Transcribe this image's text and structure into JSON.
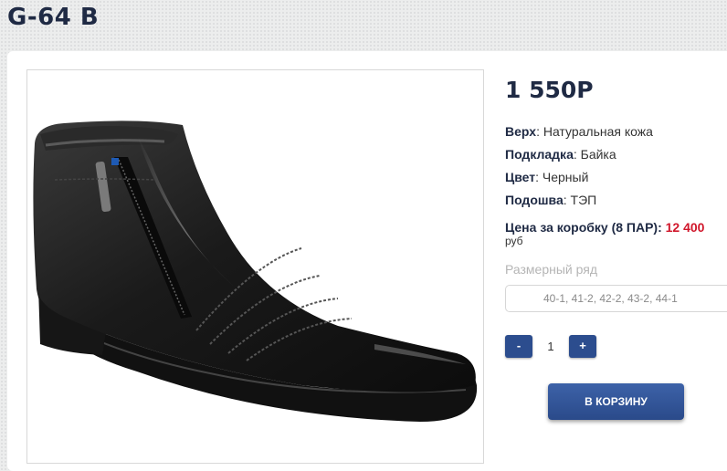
{
  "product": {
    "title": "G-64 B",
    "price": "1 550Р",
    "image_alt": "black leather ankle boot with zipper"
  },
  "specs": [
    {
      "label": "Верх",
      "value": ": Натуральная кожа"
    },
    {
      "label": "Подкладка",
      "value": ": Байка"
    },
    {
      "label": "Цвет",
      "value": ": Черный"
    },
    {
      "label": "Подошва",
      "value": ": ТЭП"
    }
  ],
  "box_price": {
    "label": "Цена за коробку (8 ПАР):",
    "value": "12 400",
    "unit": "руб"
  },
  "sizes": {
    "label": "Размерный ряд",
    "value": "40-1, 41-2, 42-2, 43-2, 44-1"
  },
  "quantity": {
    "minus": "-",
    "value": "1",
    "plus": "+"
  },
  "cart_button": "В КОРЗИНУ",
  "colors": {
    "accent": "#2c4d8e",
    "price_red": "#d0162a",
    "title": "#1f2a44"
  }
}
